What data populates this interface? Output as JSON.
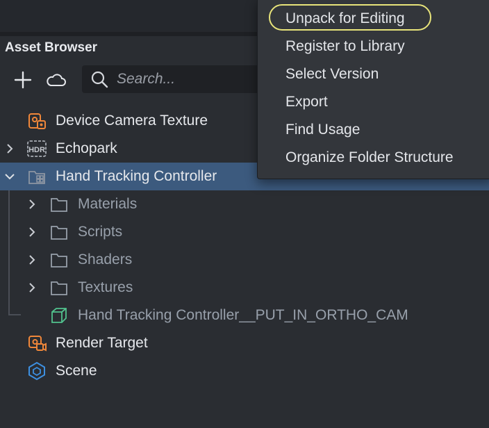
{
  "panel": {
    "title": "Asset Browser"
  },
  "toolbar": {
    "add_icon": "plus-icon",
    "cloud_icon": "cloud-icon",
    "search_placeholder": "Search..."
  },
  "tree": {
    "items": [
      {
        "label": "Device Camera Texture",
        "icon": "camera-texture-icon",
        "color": "#f0873a"
      },
      {
        "label": "Echopark",
        "icon": "hdr-icon",
        "color": "#a8adb5"
      },
      {
        "label": "Hand Tracking Controller",
        "icon": "package-icon",
        "color": "#8d96a3"
      },
      {
        "label": "Materials",
        "icon": "folder-icon"
      },
      {
        "label": "Scripts",
        "icon": "folder-icon"
      },
      {
        "label": "Shaders",
        "icon": "folder-icon"
      },
      {
        "label": "Textures",
        "icon": "folder-icon"
      },
      {
        "label": "Hand Tracking Controller__PUT_IN_ORTHO_CAM",
        "icon": "prefab-cube-icon",
        "color": "#52c28e"
      },
      {
        "label": "Render Target",
        "icon": "render-target-icon",
        "color": "#f0873a"
      },
      {
        "label": "Scene",
        "icon": "scene-icon",
        "color": "#3d8fe0"
      }
    ]
  },
  "context_menu": {
    "items": [
      "Unpack for Editing",
      "Register to Library",
      "Select Version",
      "Export",
      "Find Usage",
      "Organize Folder Structure"
    ],
    "highlight_color": "#e8e47a"
  },
  "colors": {
    "selected_row": "#3c5a7e",
    "background": "#2a2d32"
  }
}
